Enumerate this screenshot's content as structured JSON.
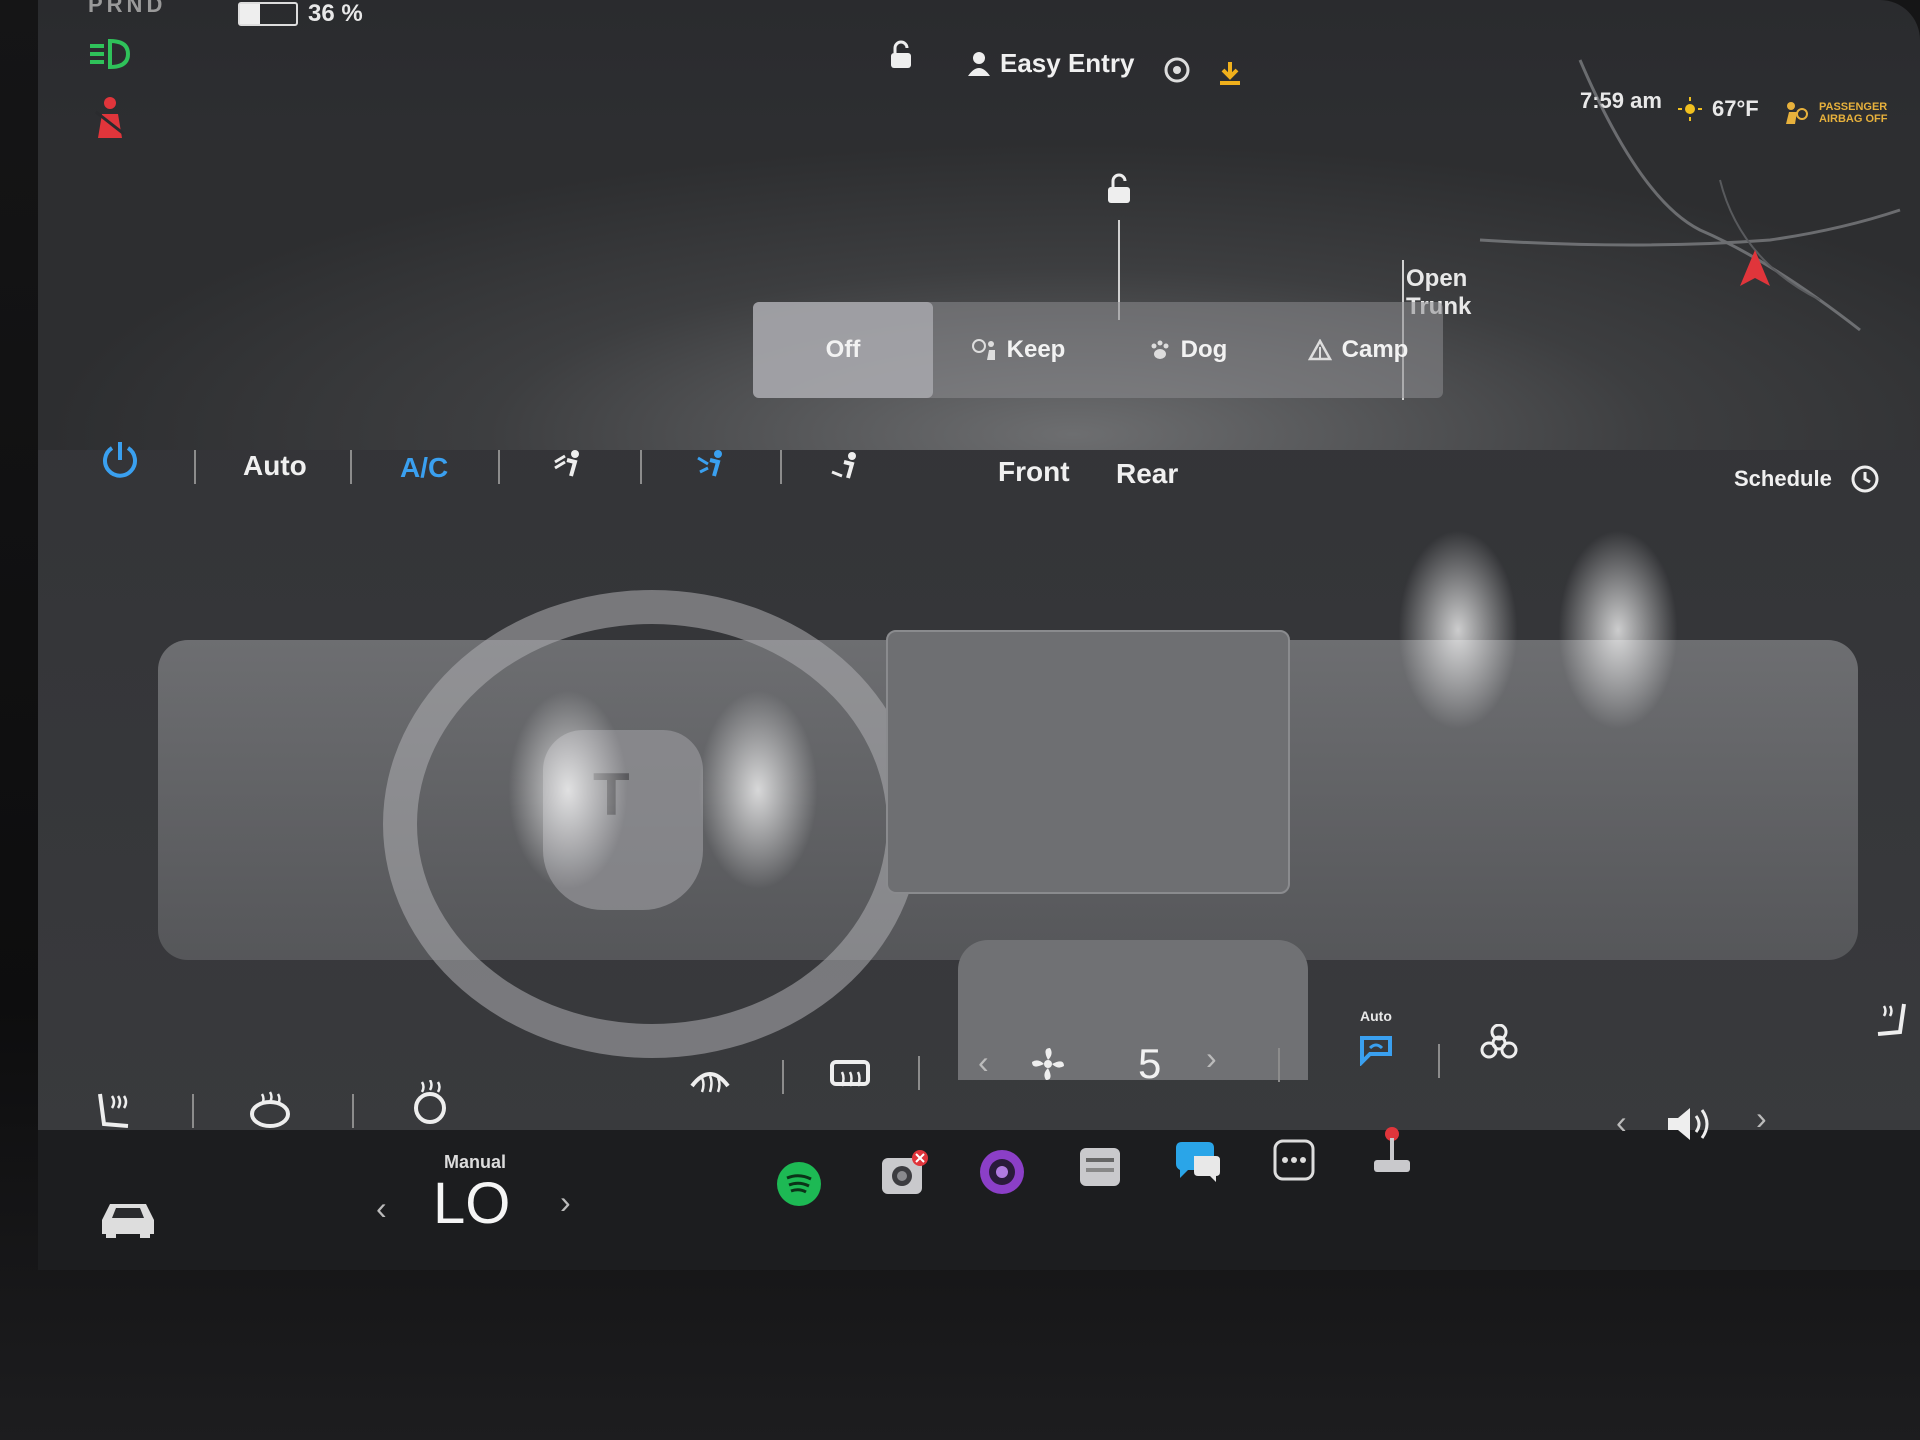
{
  "status": {
    "gear": "PRND",
    "battery": "36 %",
    "battery_level": 0.36,
    "profile_name": "Easy Entry",
    "time": "7:59 am",
    "temperature": "67°F",
    "airbag_text_1": "PASSENGER",
    "airbag_text_2": "AIRBAG OFF"
  },
  "car": {
    "open_trunk_1": "Open",
    "open_trunk_2": "Trunk"
  },
  "climate_modes": [
    {
      "label": "Off"
    },
    {
      "label": "Keep"
    },
    {
      "label": "Dog"
    },
    {
      "label": "Camp"
    }
  ],
  "climate_bar": {
    "auto": "Auto",
    "ac": "A/C",
    "front": "Front",
    "rear": "Rear",
    "schedule": "Schedule"
  },
  "fan": {
    "speed": "5",
    "auto_label": "Auto"
  },
  "dock": {
    "temp_mode": "Manual",
    "temp_value": "LO"
  },
  "colors": {
    "accent_blue": "#3aa0f0",
    "spotify_green": "#1db954",
    "warning_red": "#e0353b",
    "headlight_green": "#2fc25a"
  }
}
